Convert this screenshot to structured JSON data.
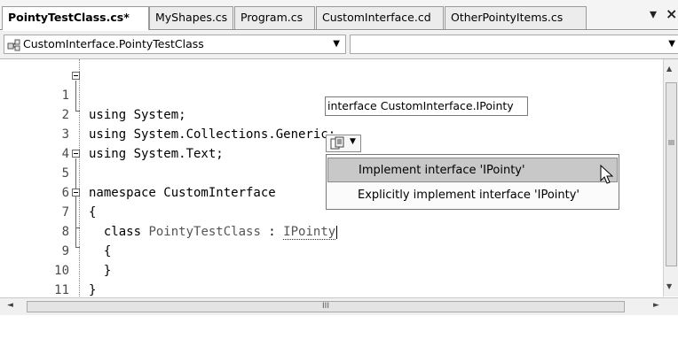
{
  "tabs": [
    {
      "label": "PointyTestClass.cs*",
      "active": true
    },
    {
      "label": "MyShapes.cs",
      "active": false
    },
    {
      "label": "Program.cs",
      "active": false
    },
    {
      "label": "CustomInterface.cd",
      "active": false
    },
    {
      "label": "OtherPointyItems.cs",
      "active": false
    }
  ],
  "tabbar_controls": {
    "dropdown_glyph": "▾",
    "close_glyph": "×"
  },
  "navbar": {
    "type_combo": "CustomInterface.PointyTestClass",
    "member_combo": "",
    "combo_arrow": "▼"
  },
  "code_lines": [
    {
      "number": "1",
      "text": "using System;"
    },
    {
      "number": "2",
      "text": "using System.Collections.Generic;"
    },
    {
      "number": "3",
      "text": "using System.Text;"
    },
    {
      "number": "4",
      "text": ""
    },
    {
      "number": "5",
      "text": "namespace CustomInterface"
    },
    {
      "number": "6",
      "text": "{"
    },
    {
      "number": "7",
      "prefix": "  class ",
      "type_name": "PointyTestClass",
      "mid": " : ",
      "interface_name": "IPointy"
    },
    {
      "number": "8",
      "text": "  {"
    },
    {
      "number": "9",
      "text": "  }"
    },
    {
      "number": "10",
      "text": "}"
    },
    {
      "number": "11",
      "text": ""
    }
  ],
  "tooltip": "interface CustomInterface.IPointy",
  "smart_tag_menu": {
    "items": [
      {
        "label": "Implement interface 'IPointy'",
        "highlighted": true
      },
      {
        "label": "Explicitly implement interface 'IPointy'",
        "highlighted": false
      }
    ]
  },
  "scrollbar": {
    "grip": "III",
    "left_arrow": "◄",
    "right_arrow": "►",
    "up_arrow": "▲",
    "down_arrow": "▼"
  },
  "colors": {
    "highlight": "#c8c8c8",
    "type_name": "#555555"
  }
}
